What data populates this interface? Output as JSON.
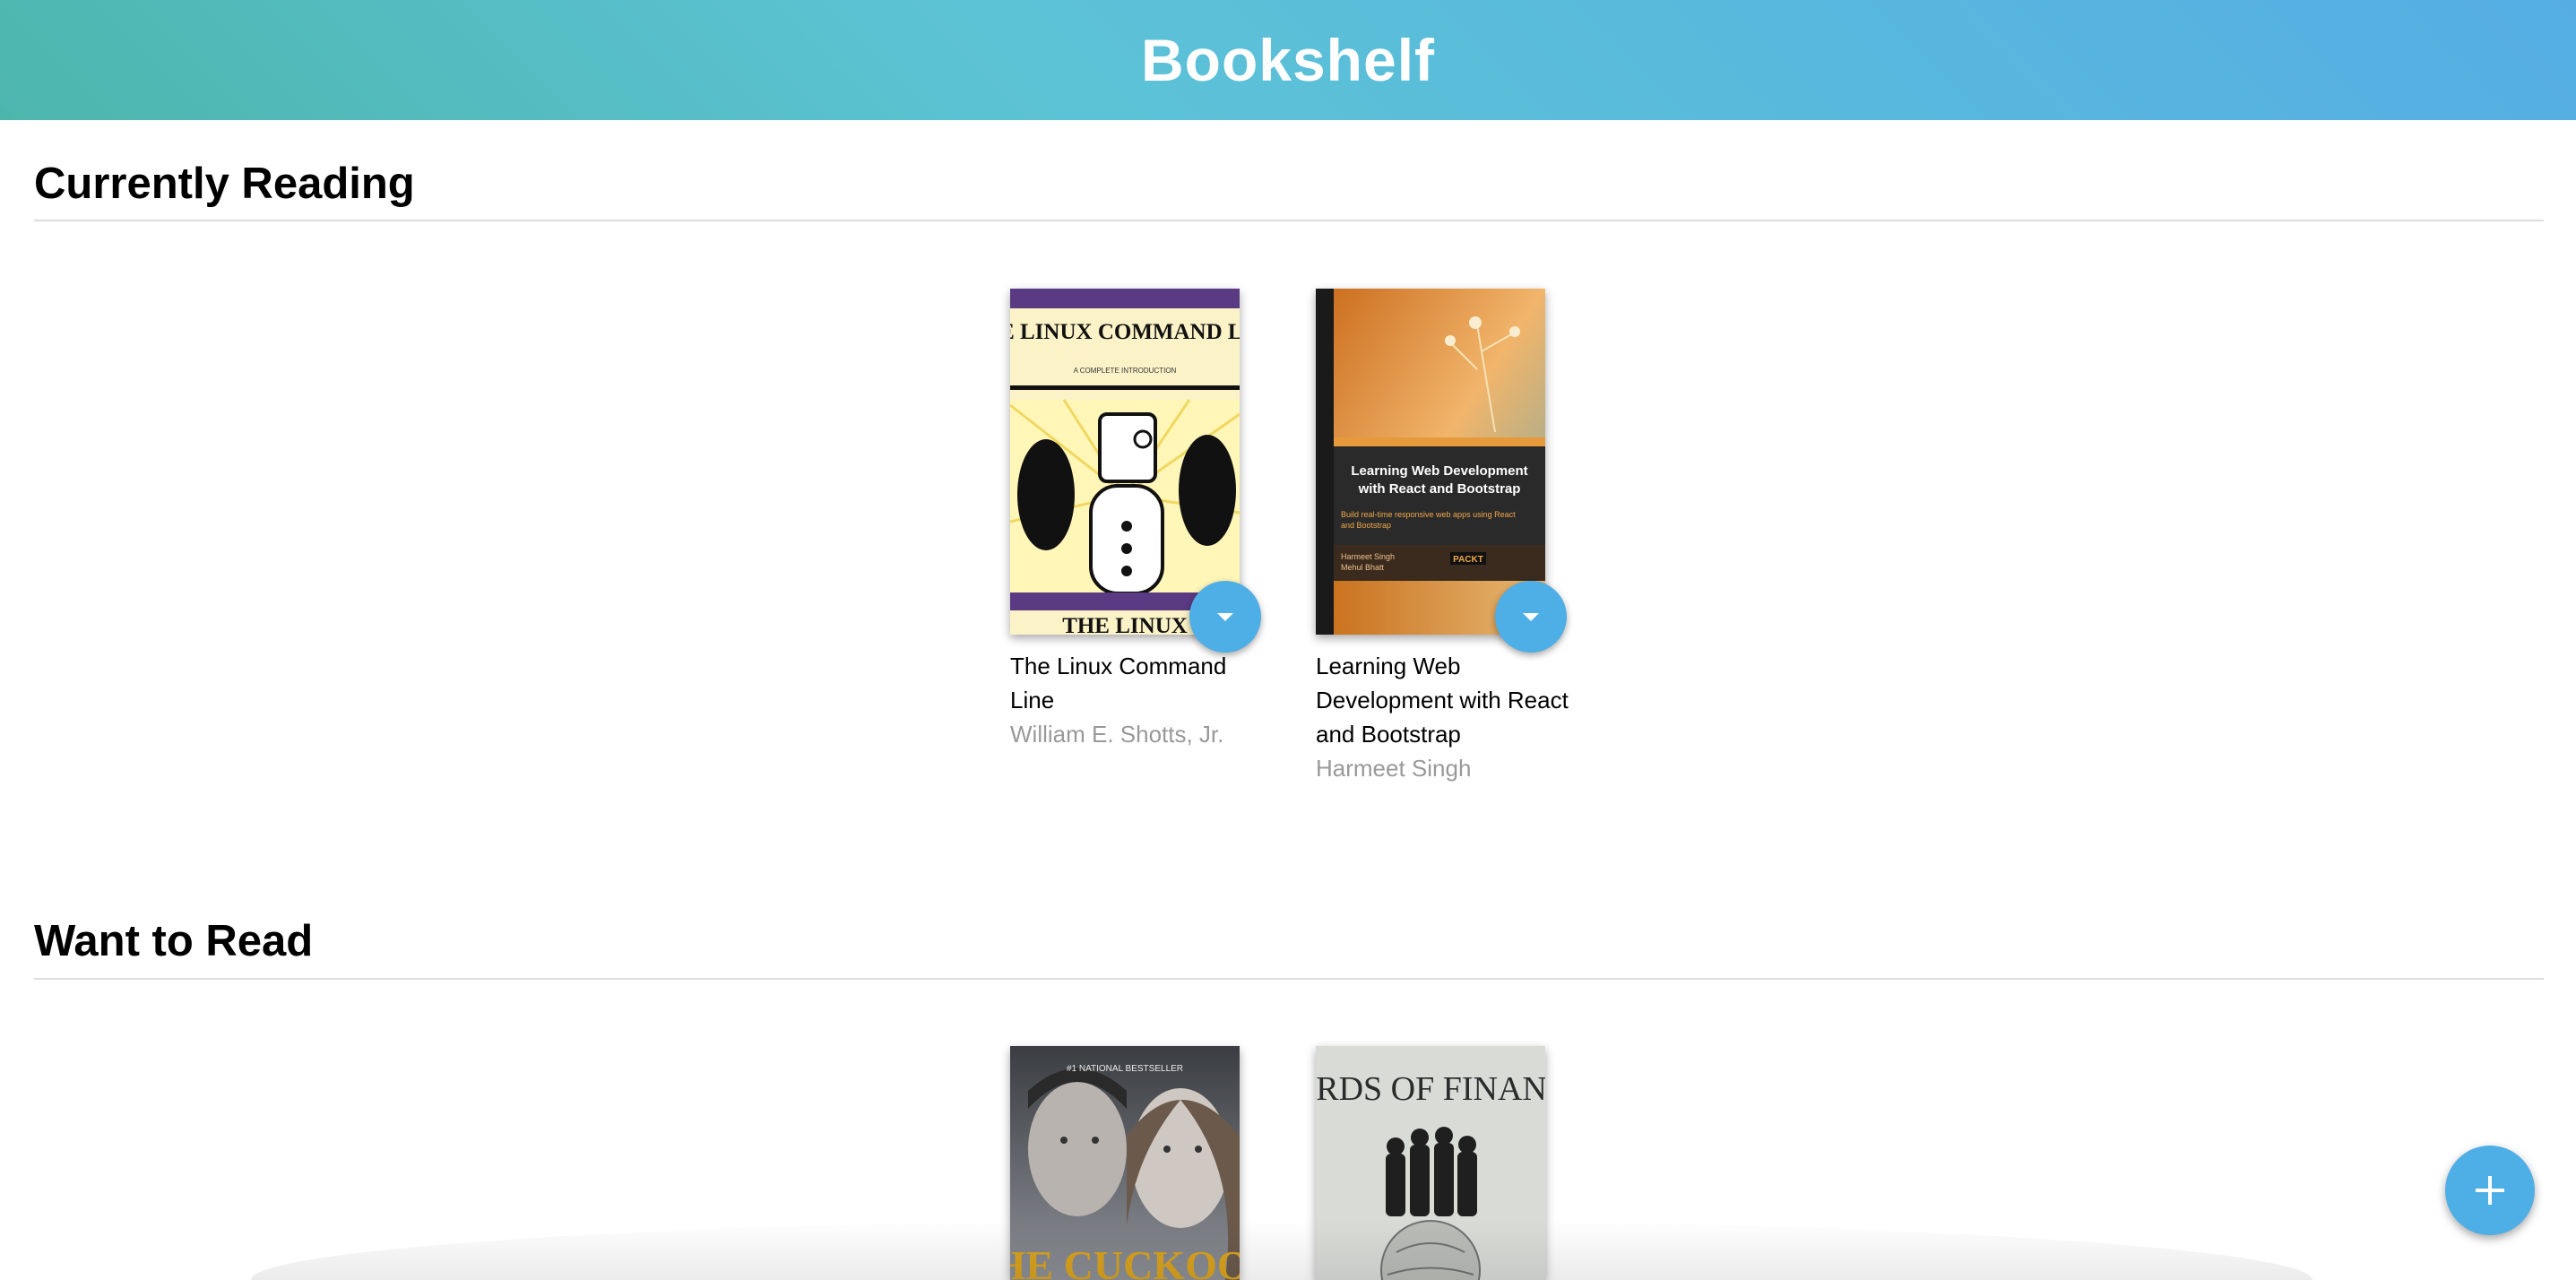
{
  "app": {
    "title": "Bookshelf"
  },
  "shelves": [
    {
      "title": "Currently Reading",
      "books": [
        {
          "title": "The Linux Command Line",
          "author": "William E. Shotts, Jr.",
          "cover_text": "THE LINUX COMMAND LINE",
          "cover_subtitle": "A COMPLETE INTRODUCTION"
        },
        {
          "title": "Learning Web Development with React and Bootstrap",
          "author": "Harmeet Singh",
          "cover_text": "Learning Web Development with React and Bootstrap",
          "cover_publisher": "PACKT"
        }
      ]
    },
    {
      "title": "Want to Read",
      "books": [
        {
          "cover_text": "THE CUCKOO'S",
          "cover_banner": "#1 NATIONAL BESTSELLER"
        },
        {
          "cover_text": "LORDS OF FINANCE"
        }
      ]
    }
  ],
  "colors": {
    "header_start": "#4db6ac",
    "header_end": "#55ade4",
    "accent": "#4eaee6"
  },
  "icons": {
    "shelf_changer": "caret-down-icon",
    "add": "plus-icon"
  }
}
